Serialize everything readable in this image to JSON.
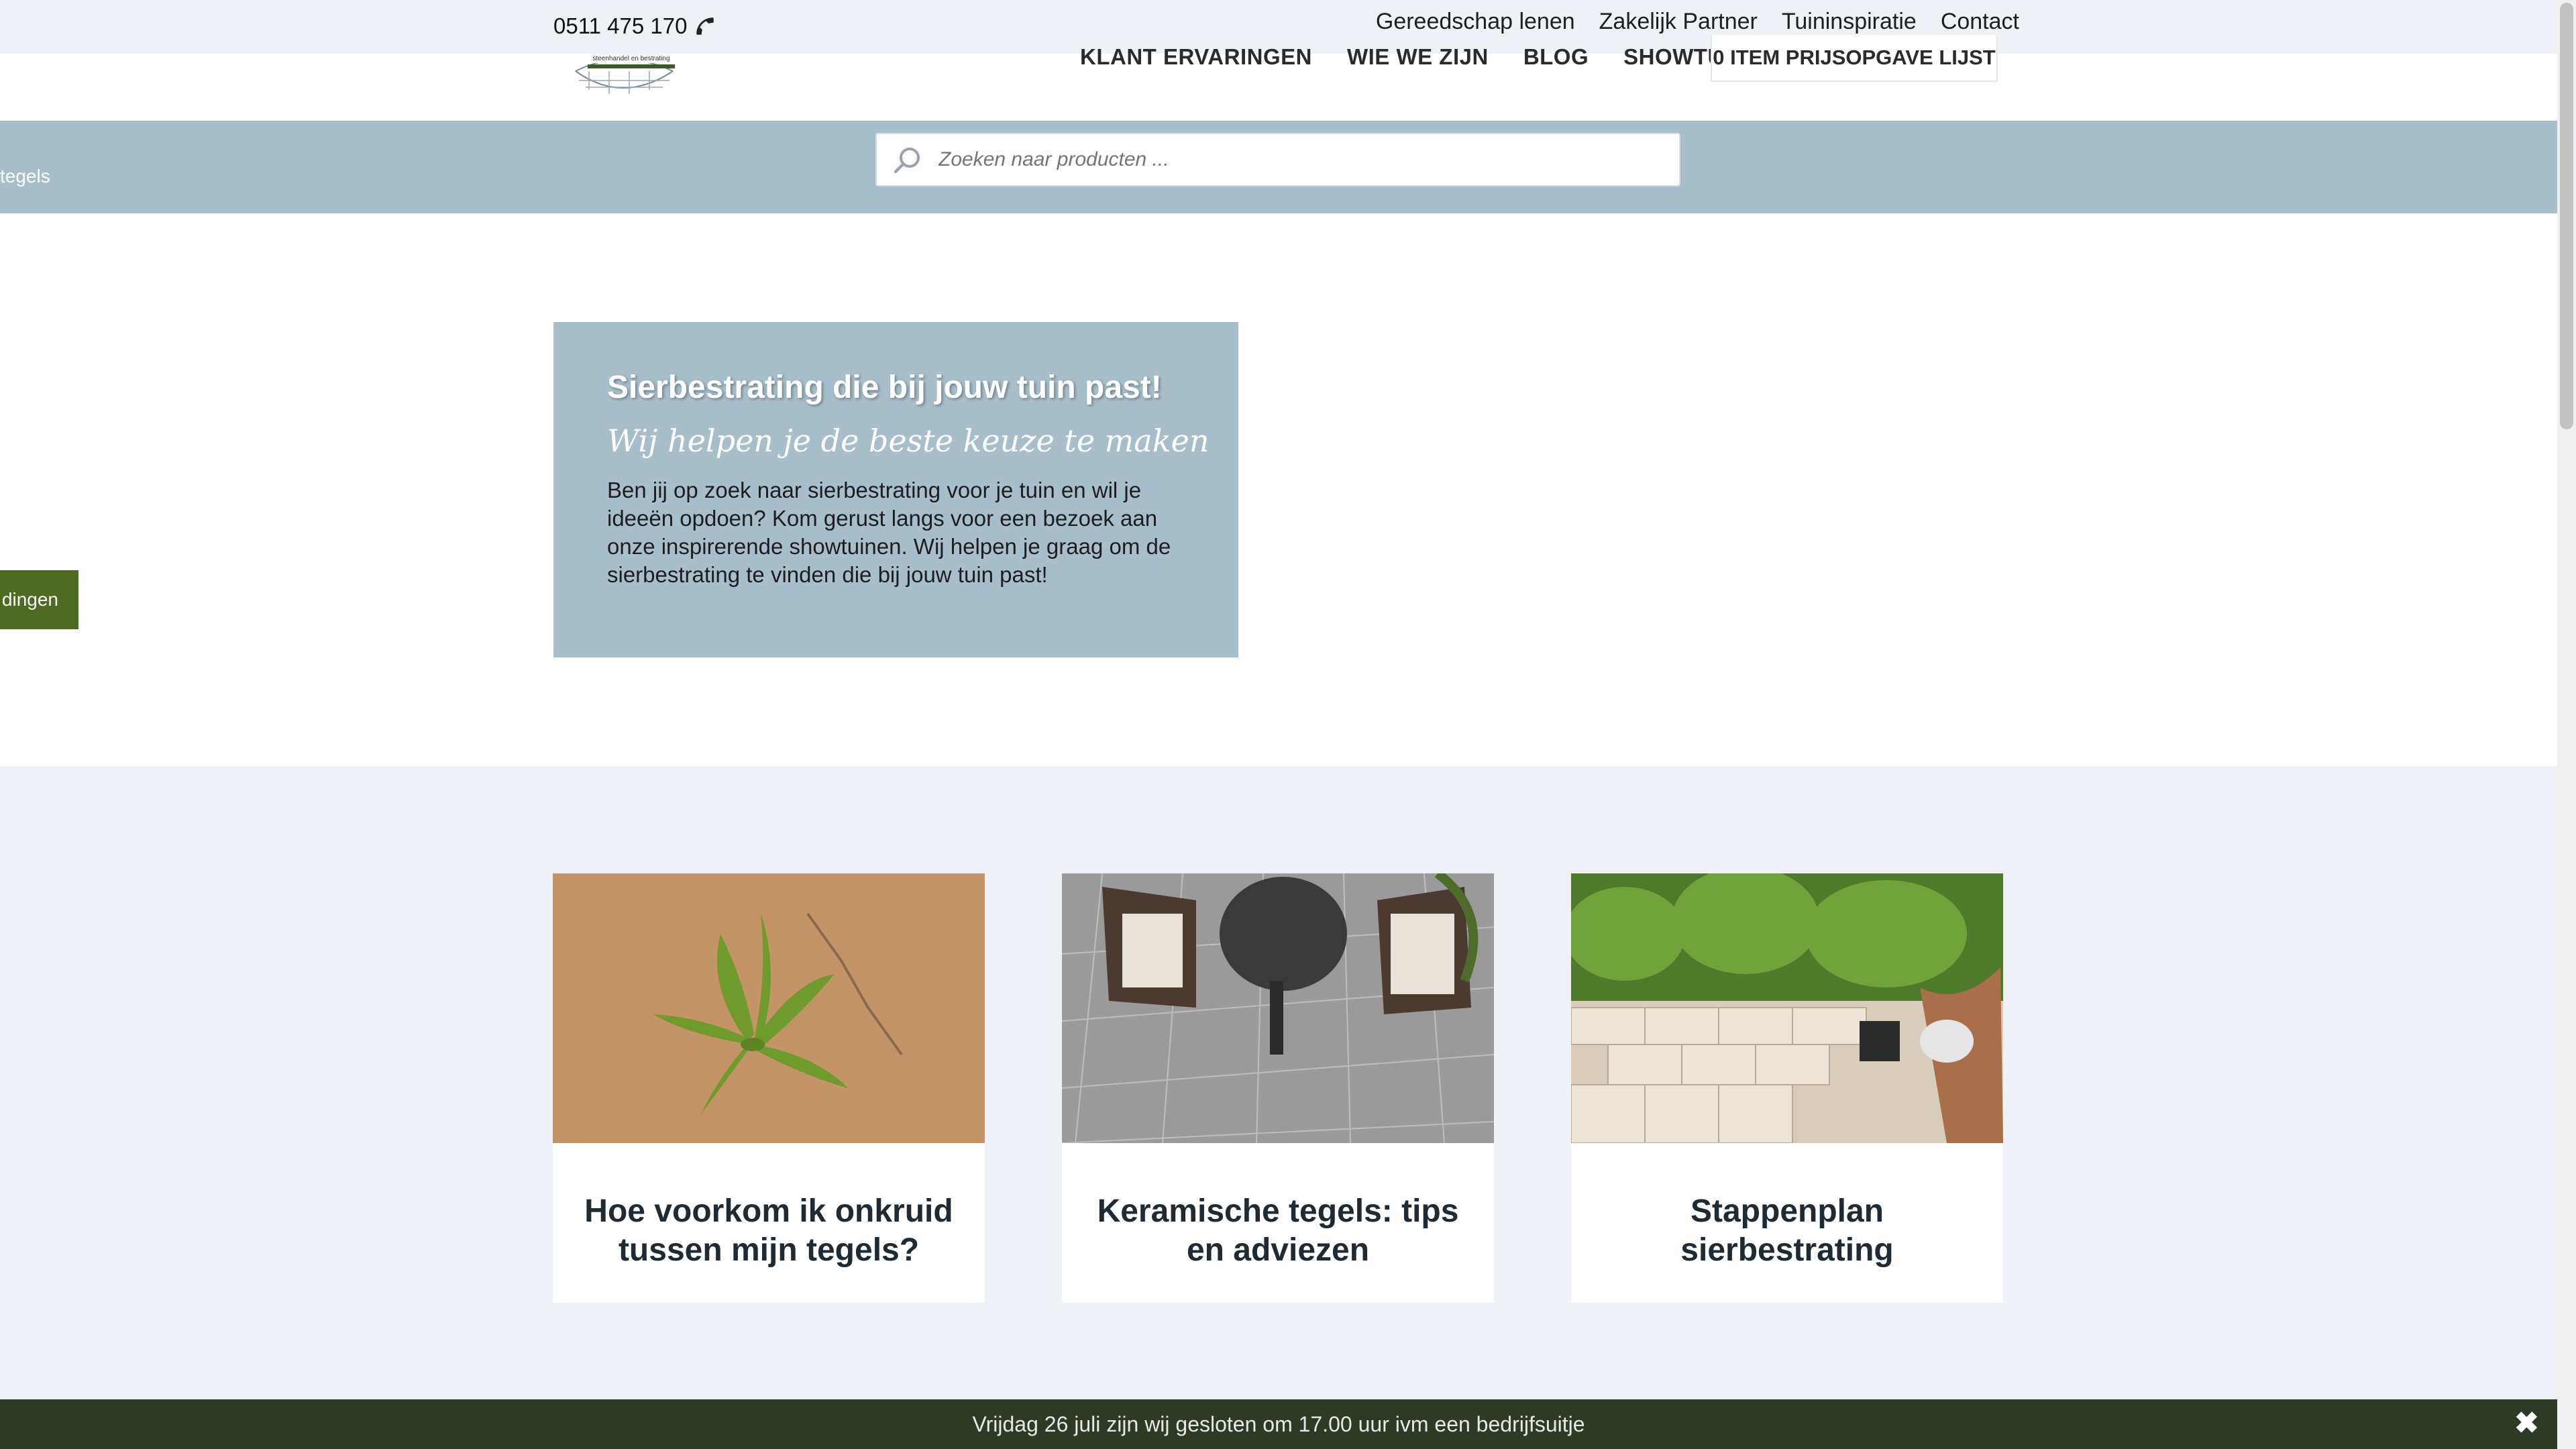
{
  "topbar": {
    "phone": "0511 475 170",
    "links": [
      "Gereedschap lenen",
      "Zakelijk Partner",
      "Tuininspiratie",
      "Contact"
    ]
  },
  "nav": {
    "logo_text": "steenhandel en bestrating",
    "items": [
      "KLANT ERVARINGEN",
      "WIE WE ZIJN",
      "BLOG",
      "SHOWTUIN"
    ],
    "quote_button": "0 ITEM PRIJSOPGAVE LIJST"
  },
  "search": {
    "placeholder": "Zoeken naar producten ...",
    "breadcrumb_partial": "tegels"
  },
  "hero": {
    "title": "Sierbestrating die bij jouw tuin past!",
    "subtitle": "Wij helpen je de beste keuze te maken",
    "body": "Ben jij op zoek naar sierbestrating voor je tuin en wil je ideeën opdoen? Kom gerust langs voor een bezoek aan onze inspirerende showtuinen. Wij helpen je graag om de sierbestrating te vinden die bij jouw tuin past!"
  },
  "side_button": "dingen",
  "blog": {
    "cards": [
      {
        "title": "Hoe voorkom ik onkruid tussen mijn tegels?",
        "image": "weed-between-tiles"
      },
      {
        "title": "Keramische tegels: tips en adviezen",
        "image": "ceramic-tiles-patio"
      },
      {
        "title": "Stappenplan sierbestrating",
        "image": "laying-pavers"
      }
    ]
  },
  "notice": {
    "text": "Vrijdag 26 juli zijn wij gesloten om 17.00 uur ivm een bedrijfsuitje",
    "close": "✖"
  },
  "colors": {
    "accent_blue": "#a6bfcb",
    "side_green": "#4d6a21",
    "notice_bg": "#2e3a26",
    "section_bg": "#eef2f7"
  }
}
